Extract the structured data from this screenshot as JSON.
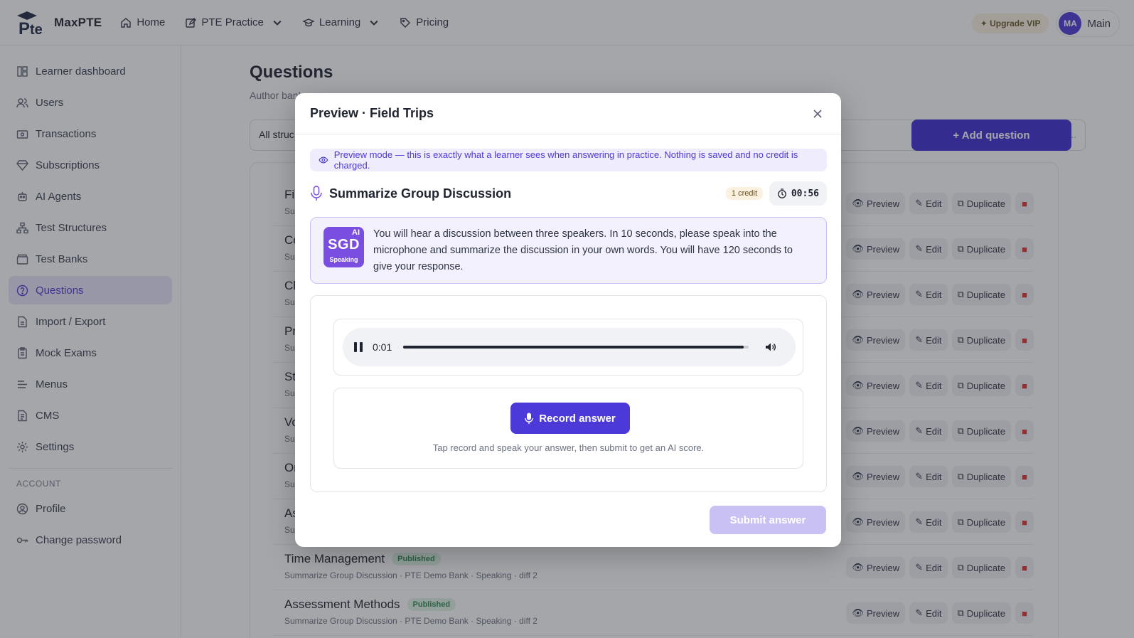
{
  "app": {
    "name": "MaxPTE"
  },
  "nav": [
    {
      "label": "Home",
      "icon": "home-icon"
    },
    {
      "label": "PTE Practice",
      "icon": "edit-icon"
    },
    {
      "label": "Learning",
      "icon": "graduation-cap-icon"
    },
    {
      "label": "Pricing",
      "icon": "tag-icon"
    }
  ],
  "topbar": {
    "vip_label": "✦ Upgrade VIP",
    "avatar_initials": "MA",
    "user_name": "Main"
  },
  "sidebar": {
    "items": [
      {
        "label": "Learner dashboard",
        "icon": "dashboard-icon"
      },
      {
        "label": "Users",
        "icon": "users-icon"
      },
      {
        "label": "Transactions",
        "icon": "wallet-icon"
      },
      {
        "label": "Subscriptions",
        "icon": "diamond-icon"
      },
      {
        "label": "AI Agents",
        "icon": "robot-icon"
      },
      {
        "label": "Test Structures",
        "icon": "hierarchy-icon"
      },
      {
        "label": "Test Banks",
        "icon": "folder-icon"
      },
      {
        "label": "Questions",
        "icon": "question-icon",
        "active": true
      },
      {
        "label": "Import / Export",
        "icon": "file-icon"
      },
      {
        "label": "Mock Exams",
        "icon": "clipboard-icon"
      },
      {
        "label": "Menus",
        "icon": "menu-icon"
      },
      {
        "label": "CMS",
        "icon": "document-icon"
      },
      {
        "label": "Settings",
        "icon": "gear-icon"
      }
    ],
    "account_label": "ACCOUNT",
    "account_items": [
      {
        "label": "Profile",
        "icon": "user-circle-icon"
      },
      {
        "label": "Change password",
        "icon": "key-icon"
      }
    ]
  },
  "main": {
    "title": "Questions",
    "subtitle": "Author bank",
    "filter_value": "All struc",
    "search_placeholder": "on...",
    "add_label": "+ Add question",
    "rows": [
      {
        "title": "Fie",
        "sub": "Su"
      },
      {
        "title": "Co",
        "sub": "Su"
      },
      {
        "title": "Cl",
        "sub": "Su"
      },
      {
        "title": "Pr",
        "sub": "Su"
      },
      {
        "title": "St",
        "sub": "Su"
      },
      {
        "title": "Vo",
        "sub": "Su"
      },
      {
        "title": "Or",
        "sub": "Su"
      },
      {
        "title": "As",
        "sub": "Su"
      },
      {
        "title": "Time Management",
        "badge": "Published",
        "sub": "Summarize Group Discussion · PTE Demo Bank · Speaking · diff 2"
      },
      {
        "title": "Assessment Methods",
        "badge": "Published",
        "sub": "Summarize Group Discussion · PTE Demo Bank · Speaking · diff 2"
      }
    ],
    "actions": {
      "preview": "Preview",
      "edit": "Edit",
      "duplicate": "Duplicate"
    }
  },
  "modal": {
    "title": "Preview · Field Trips",
    "notice": "Preview mode — this is exactly what a learner sees when answering in practice. Nothing is saved and no credit is charged.",
    "question_type": "Summarize Group Discussion",
    "credit": "1 credit",
    "timer": "00:56",
    "badge": {
      "main": "SGD",
      "ai": "AI",
      "sub": "Speaking"
    },
    "instructions": "You will hear a discussion between three speakers. In 10 seconds, please speak into the microphone and summarize the discussion in your own words. You will have 120 seconds to give your response.",
    "audio": {
      "time": "0:01",
      "progress": 0.985
    },
    "record_label": "Record answer",
    "record_hint": "Tap record and speak your answer, then submit to get an AI score.",
    "submit_label": "Submit answer"
  },
  "colors": {
    "accent": "#4c3ad8",
    "accent_dark": "#3f2ed1",
    "published": "#2f8a52"
  }
}
